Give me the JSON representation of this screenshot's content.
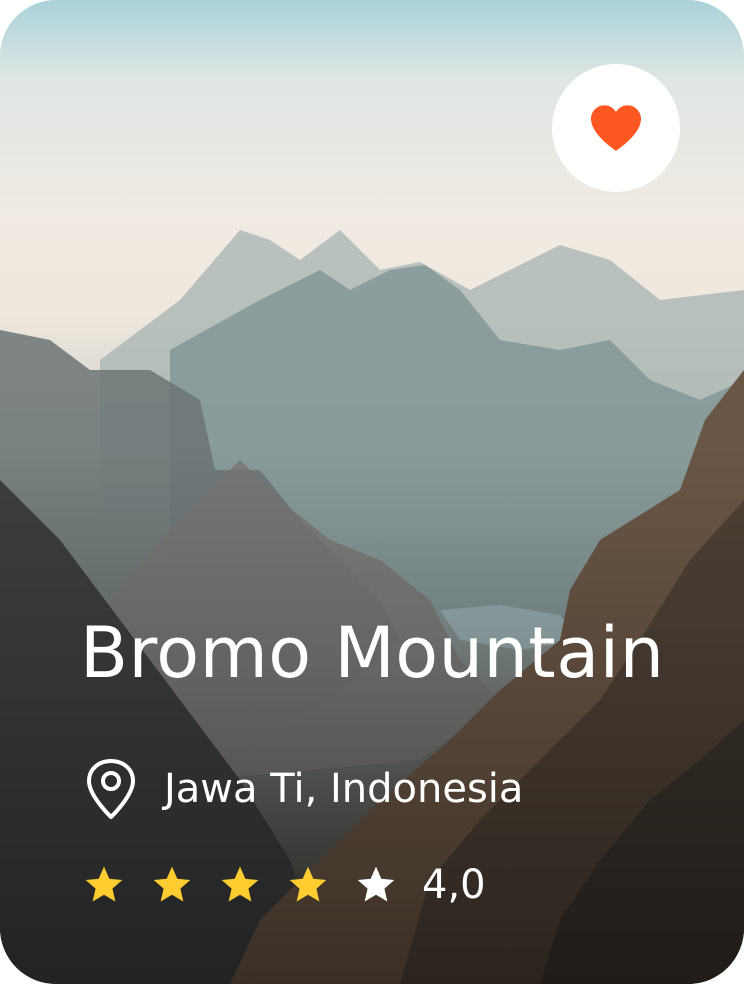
{
  "card": {
    "title": "Bromo Mountain",
    "location": "Jawa Ti, Indonesia",
    "rating": {
      "value": "4,0",
      "stars_filled": 4,
      "stars_total": 5
    },
    "favorite": {
      "active": true,
      "icon": "heart-icon"
    },
    "location_icon": "map-pin-icon",
    "star_icon": "star-icon"
  },
  "colors": {
    "heart": "#ff5722",
    "star_filled": "#ffcd30",
    "star_empty": "#ffffff",
    "text": "#ffffff",
    "favorite_bg": "#ffffff"
  }
}
